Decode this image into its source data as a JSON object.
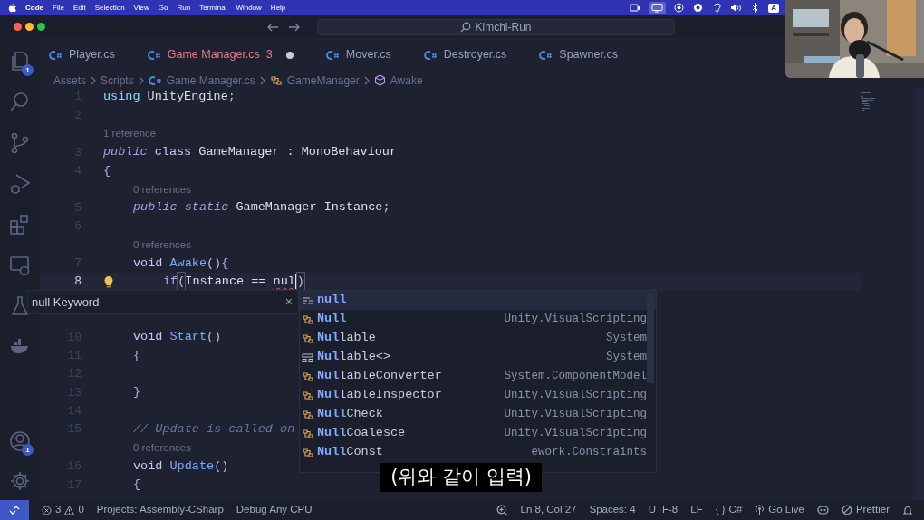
{
  "menu_bar": {
    "app": "Code",
    "menus": [
      "File",
      "Edit",
      "Selection",
      "View",
      "Go",
      "Run",
      "Terminal",
      "Window",
      "Help"
    ],
    "status_icons": [
      {
        "kind": "video",
        "selected": false
      },
      {
        "kind": "screen",
        "selected": true
      },
      {
        "kind": "record",
        "selected": false
      },
      {
        "kind": "sync",
        "selected": false
      },
      {
        "kind": "ear",
        "selected": false
      },
      {
        "kind": "volume",
        "selected": false
      },
      {
        "kind": "bluetooth",
        "selected": false
      }
    ],
    "input_source": "A"
  },
  "title_bar": {
    "search": "Kimchi-Run"
  },
  "activity_bar": [
    {
      "kind": "explorer",
      "badge": "1"
    },
    {
      "kind": "search"
    },
    {
      "kind": "source-control"
    },
    {
      "kind": "run-debug"
    },
    {
      "kind": "extensions"
    },
    {
      "kind": "remote"
    },
    {
      "kind": "testing"
    },
    {
      "kind": "docker"
    }
  ],
  "activity_bottom": [
    {
      "kind": "account",
      "badge": "1"
    },
    {
      "kind": "settings"
    }
  ],
  "tabs": [
    {
      "label": "Player.cs",
      "selected": false,
      "dirty": false
    },
    {
      "label": "Game Manager.cs",
      "selected": true,
      "problems": "3",
      "dirty": true
    },
    {
      "label": "Mover.cs",
      "selected": false,
      "dirty": false
    },
    {
      "label": "Destroyer.cs",
      "selected": false,
      "dirty": false
    },
    {
      "label": "Spawner.cs",
      "selected": false,
      "dirty": false
    }
  ],
  "breadcrumbs": [
    {
      "kind": "folder",
      "label": "Assets"
    },
    {
      "kind": "folder",
      "label": "Scripts"
    },
    {
      "kind": "file",
      "label": "Game Manager.cs"
    },
    {
      "kind": "class",
      "label": "GameManager"
    },
    {
      "kind": "method",
      "label": "Awake"
    }
  ],
  "lines": [
    {
      "kind": "code",
      "number": "1",
      "current": false,
      "tokens": [
        {
          "kind": "keyword",
          "text": "using"
        },
        {
          "kind": "type",
          "text": " UnityEngine"
        },
        {
          "kind": "punct",
          "text": ";"
        }
      ]
    },
    {
      "kind": "code",
      "number": "2",
      "current": false
    },
    {
      "kind": "lens",
      "text": "1 reference"
    },
    {
      "kind": "code",
      "number": "3",
      "current": false,
      "tokens": [
        {
          "kind": "storage",
          "text": "public"
        },
        {
          "kind": "decl",
          "text": " class"
        },
        {
          "kind": "type",
          "text": " GameManager : MonoBehaviour"
        }
      ]
    },
    {
      "kind": "code",
      "number": "4",
      "current": false,
      "tokens": [
        {
          "kind": "brace",
          "text": "{"
        }
      ],
      "children": [
        {
          "kind": "lens",
          "text": "0 references"
        },
        {
          "kind": "code",
          "number": "5",
          "current": false,
          "tokens": [
            {
              "kind": "storage",
              "text": "public static"
            },
            {
              "kind": "type",
              "text": " GameManager Instance"
            },
            {
              "kind": "punct",
              "text": ";"
            }
          ]
        },
        {
          "kind": "code",
          "number": "6",
          "current": false
        },
        {
          "kind": "lens",
          "text": "0 references"
        },
        {
          "kind": "code",
          "number": "7",
          "current": false,
          "tokens": [
            {
              "kind": "decl",
              "text": "void"
            },
            {
              "kind": "func",
              "text": " Awake"
            },
            {
              "kind": "punct",
              "text": "()"
            },
            {
              "kind": "brace",
              "text": "{"
            }
          ],
          "children": [
            {
              "kind": "code",
              "number": "8",
              "current": true,
              "lightbulb": true,
              "tokens": [
                {
                  "kind": "control",
                  "text": "if"
                },
                {
                  "kind": "bracket",
                  "text": "("
                },
                {
                  "kind": "type",
                  "text": "Instance == "
                },
                {
                  "kind": "error",
                  "text": "nul",
                  "cursor": true
                },
                {
                  "kind": "bracket",
                  "text": ")"
                }
              ]
            }
          ]
        },
        {
          "kind": "code",
          "number": "10",
          "current": false,
          "tokens": [
            {
              "kind": "decl",
              "text": "void"
            },
            {
              "kind": "func",
              "text": " Start"
            },
            {
              "kind": "punct",
              "text": "()"
            }
          ]
        },
        {
          "kind": "code",
          "number": "11",
          "current": false,
          "tokens": [
            {
              "kind": "brace",
              "text": "{"
            }
          ],
          "children": [
            {
              "kind": "code",
              "number": "12",
              "current": false
            }
          ]
        },
        {
          "kind": "code",
          "number": "13",
          "current": false,
          "tokens": [
            {
              "kind": "brace",
              "text": "}"
            }
          ]
        },
        {
          "kind": "code",
          "number": "14",
          "current": false
        },
        {
          "kind": "code",
          "number": "15",
          "current": false,
          "tokens": [
            {
              "kind": "comment",
              "text": "// Update is called on"
            }
          ]
        },
        {
          "kind": "lens",
          "text": "0 references"
        },
        {
          "kind": "code",
          "number": "16",
          "current": false,
          "tokens": [
            {
              "kind": "decl",
              "text": "void"
            },
            {
              "kind": "func",
              "text": " Update"
            },
            {
              "kind": "punct",
              "text": "()"
            }
          ]
        },
        {
          "kind": "code",
          "number": "17",
          "current": false,
          "tokens": [
            {
              "kind": "brace",
              "text": "{"
            }
          ]
        }
      ]
    }
  ],
  "hover": {
    "title": "null Keyword",
    "close": "×"
  },
  "suggestions": [
    {
      "kind": "keyword",
      "label": "**null**",
      "selected": true
    },
    {
      "kind": "class",
      "label": "**Null**",
      "detail": "Unity.VisualScripting",
      "selected": false
    },
    {
      "kind": "class",
      "label": "**Nul**lable",
      "detail": "System",
      "selected": false
    },
    {
      "kind": "struct",
      "label": "**Nul**lable<>",
      "detail": "System",
      "selected": false
    },
    {
      "kind": "class",
      "label": "**Nul**lableConverter",
      "detail": "System.ComponentModel",
      "selected": false
    },
    {
      "kind": "class",
      "label": "**Nul**lableInspector",
      "detail": "Unity.VisualScripting",
      "selected": false
    },
    {
      "kind": "class",
      "label": "**Null**Check",
      "detail": "Unity.VisualScripting",
      "selected": false
    },
    {
      "kind": "class",
      "label": "**Null**Coalesce",
      "detail": "Unity.VisualScripting",
      "selected": false
    },
    {
      "kind": "class",
      "label": "**Null**Const",
      "detail": "ework.Constraints",
      "selected": false
    }
  ],
  "status_bar": {
    "errors": "3",
    "warnings": "0",
    "left": [
      "Projects: Assembly-CSharp",
      "Debug Any CPU"
    ],
    "right": [
      {
        "kind": "zoom"
      },
      {
        "kind": "text",
        "text": "Ln 8, Col 27"
      },
      {
        "kind": "text",
        "text": "Spaces: 4"
      },
      {
        "kind": "text",
        "text": "UTF-8"
      },
      {
        "kind": "text",
        "text": "LF"
      },
      {
        "kind": "language",
        "icon_text": "{ }",
        "text": "C#"
      },
      {
        "kind": "golive",
        "text": "Go Live"
      },
      {
        "kind": "copilot"
      },
      {
        "kind": "prettier",
        "text": "Prettier"
      },
      {
        "kind": "bell"
      }
    ]
  },
  "subtitle": "(위와 같이 입력)"
}
